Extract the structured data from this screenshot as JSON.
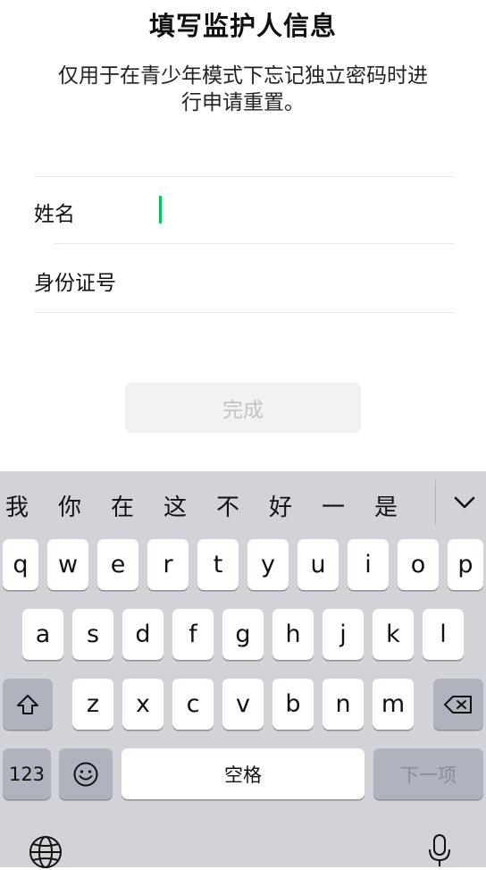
{
  "page": {
    "title": "填写监护人信息",
    "subtitle_line1": "仅用于在青少年模式下忘记独立密码时进",
    "subtitle_line2": "行申请重置。"
  },
  "form": {
    "name_label": "姓名",
    "name_value": "",
    "id_label": "身份证号",
    "id_value": ""
  },
  "done_button": "完成",
  "colors": {
    "caret": "#07c160",
    "button_disabled_bg": "#f2f2f2",
    "button_disabled_text": "#c4c4c4",
    "keyboard_bg": "#d1d3d9"
  },
  "keyboard": {
    "candidates": [
      "我",
      "你",
      "在",
      "这",
      "不",
      "好",
      "一",
      "是"
    ],
    "row1": [
      "q",
      "w",
      "e",
      "r",
      "t",
      "y",
      "u",
      "i",
      "o",
      "p"
    ],
    "row2": [
      "a",
      "s",
      "d",
      "f",
      "g",
      "h",
      "j",
      "k",
      "l"
    ],
    "row3": [
      "z",
      "x",
      "c",
      "v",
      "b",
      "n",
      "m"
    ],
    "numbers_key": "123",
    "space_key": "空格",
    "next_key": "下一项",
    "icons": [
      "chevron-down-icon",
      "shift-icon",
      "backspace-icon",
      "emoji-icon",
      "globe-icon",
      "microphone-icon"
    ]
  }
}
